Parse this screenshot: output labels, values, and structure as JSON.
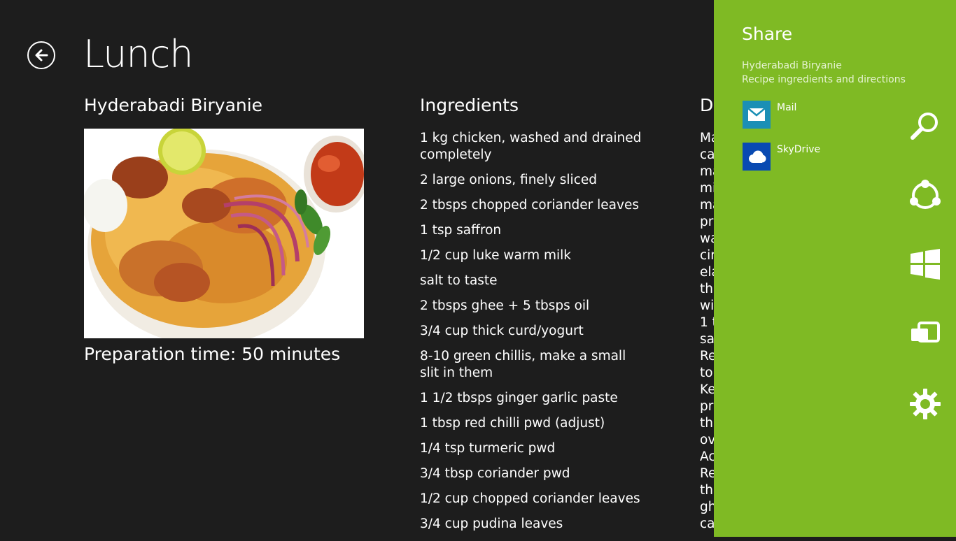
{
  "header": {
    "title": "Lunch"
  },
  "recipe": {
    "title": "Hyderabadi Biryanie",
    "prep_time": "Preparation time: 50 minutes"
  },
  "ingredients": {
    "heading": "Ingredients",
    "items": [
      "1 kg chicken, washed and drained completely",
      "2 large onions, finely sliced",
      "2 tbsps chopped coriander leaves",
      "1 tsp saffron",
      "1/2 cup luke warm milk",
      "salt to taste",
      "2 tbsps ghee + 5 tbsps oil",
      "3/4 cup thick curd/yogurt",
      "8-10 green chillis, make a small slit in them",
      "1 1/2 tbsps ginger garlic paste",
      "1 tbsp red chilli pwd (adjust)",
      "1/4 tsp turmeric pwd",
      "3/4 tbsp coriander pwd",
      "1/2 cup chopped coriander leaves",
      "3/4 cup pudina leaves"
    ]
  },
  "directions": {
    "heading": "D",
    "lines": [
      "Ma",
      "ca",
      "ma",
      "mi",
      "ma",
      "pr",
      "wa",
      "cir",
      "ela",
      "the",
      "wi",
      "1 t",
      "sa",
      "Re",
      "to",
      "Ke",
      "pr",
      "the",
      "ov",
      "Ac",
      "Re",
      "the",
      "gh",
      "ca"
    ]
  },
  "share": {
    "title": "Share",
    "subtitle_line1": "Hyderabadi Biryanie",
    "subtitle_line2": "Recipe ingredients and directions",
    "targets": [
      {
        "label": "Mail",
        "icon": "mail-icon",
        "color": "#1b8fb5"
      },
      {
        "label": "SkyDrive",
        "icon": "skydrive-icon",
        "color": "#094ab2"
      }
    ]
  },
  "charms": [
    "search-icon",
    "share-icon",
    "start-icon",
    "devices-icon",
    "settings-icon"
  ],
  "colors": {
    "background": "#1d1d1d",
    "share_pane": "#7fba24"
  }
}
